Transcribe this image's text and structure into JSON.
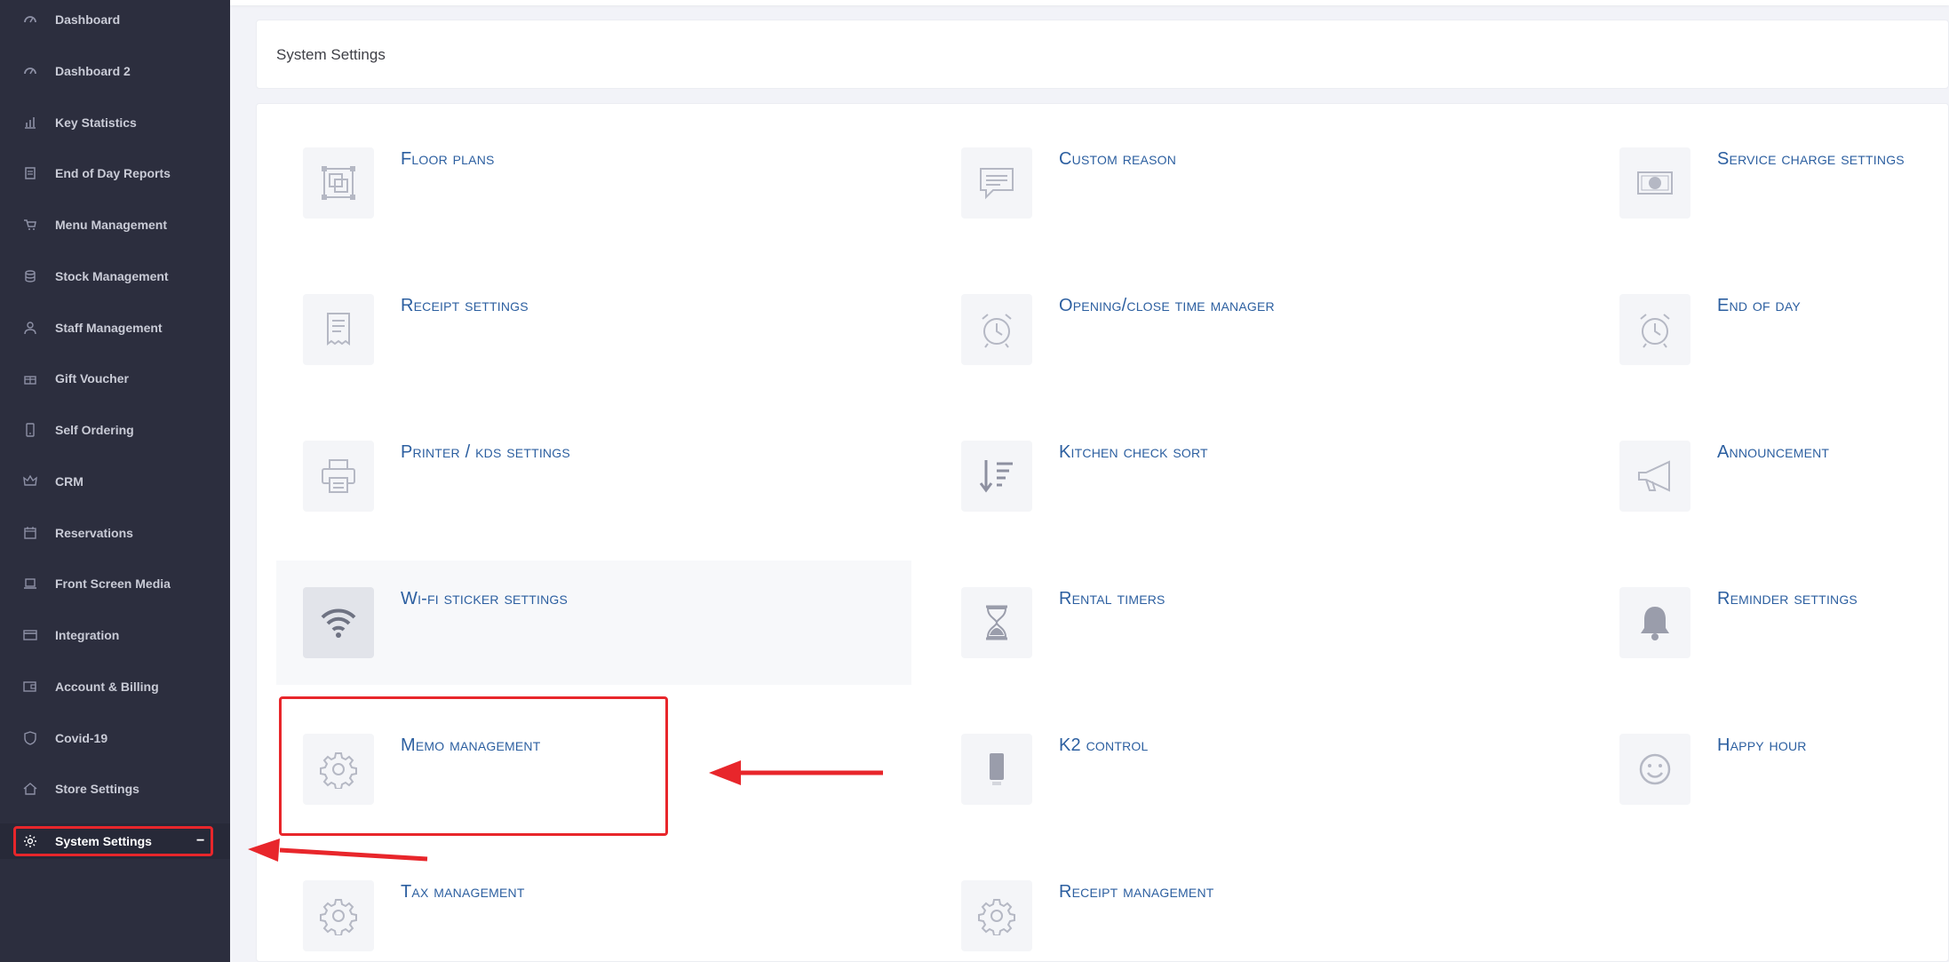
{
  "sidebar": {
    "items": [
      {
        "label": "Dashboard",
        "icon": "dashboard-icon"
      },
      {
        "label": "Dashboard 2",
        "icon": "dashboard-icon"
      },
      {
        "label": "Key Statistics",
        "icon": "bar-chart-icon"
      },
      {
        "label": "End of Day Reports",
        "icon": "report-icon"
      },
      {
        "label": "Menu Management",
        "icon": "cart-icon"
      },
      {
        "label": "Stock Management",
        "icon": "database-icon"
      },
      {
        "label": "Staff Management",
        "icon": "user-icon"
      },
      {
        "label": "Gift Voucher",
        "icon": "gift-icon"
      },
      {
        "label": "Self Ordering",
        "icon": "mobile-icon"
      },
      {
        "label": "CRM",
        "icon": "crown-icon"
      },
      {
        "label": "Reservations",
        "icon": "calendar-icon"
      },
      {
        "label": "Front Screen Media",
        "icon": "laptop-icon"
      },
      {
        "label": "Integration",
        "icon": "card-icon"
      },
      {
        "label": "Account & Billing",
        "icon": "wallet-icon"
      },
      {
        "label": "Covid-19",
        "icon": "shield-icon"
      },
      {
        "label": "Store Settings",
        "icon": "home-icon"
      },
      {
        "label": "System Settings",
        "icon": "gear-icon",
        "active": true,
        "expander": "−"
      }
    ]
  },
  "header": {
    "title": "System Settings"
  },
  "tiles": [
    {
      "label": "Floor plans",
      "icon": "floor-plan-icon"
    },
    {
      "label": "Custom reason",
      "icon": "chat-icon"
    },
    {
      "label": "Service charge settings",
      "icon": "money-icon"
    },
    {
      "label": "Receipt settings",
      "icon": "receipt-icon"
    },
    {
      "label": "Opening/close time manager",
      "icon": "alarm-clock-icon"
    },
    {
      "label": "End of day",
      "icon": "alarm-clock-icon"
    },
    {
      "label": "Printer / kds settings",
      "icon": "printer-icon"
    },
    {
      "label": "Kitchen check sort",
      "icon": "sort-icon"
    },
    {
      "label": "Announcement",
      "icon": "megaphone-icon"
    },
    {
      "label": "Wi-fi sticker settings",
      "icon": "wifi-icon"
    },
    {
      "label": "Rental timers",
      "icon": "hourglass-icon"
    },
    {
      "label": "Reminder settings",
      "icon": "bell-icon"
    },
    {
      "label": "Memo management",
      "icon": "gear-icon"
    },
    {
      "label": "K2 control",
      "icon": "device-icon"
    },
    {
      "label": "Happy hour",
      "icon": "smiley-icon"
    },
    {
      "label": "Tax management",
      "icon": "gear-icon"
    },
    {
      "label": "Receipt management",
      "icon": "gear-icon"
    }
  ],
  "colors": {
    "sidebar_bg": "#2c2e3e",
    "link": "#2c5fa0",
    "annotation_red": "#e8262b"
  }
}
